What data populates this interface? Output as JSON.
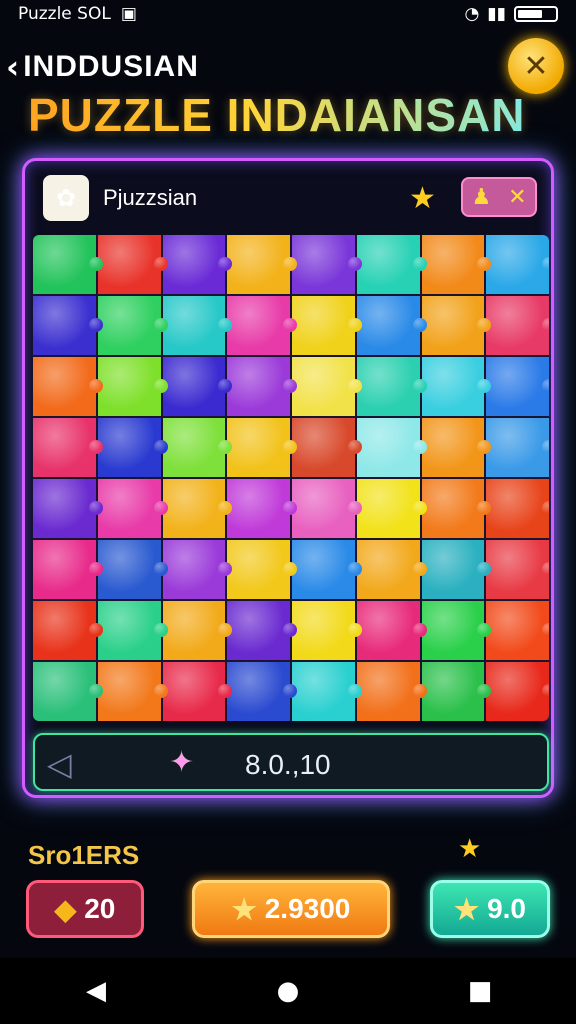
{
  "statusbar": {
    "app_label": "Puzzle SOL",
    "app_icon": "image-icon",
    "icons": [
      "wifi-icon",
      "signal-icon",
      "battery-icon"
    ]
  },
  "header": {
    "back_label": "INDDUSIAN",
    "title": "PUZZLE INDAIANSAN"
  },
  "panel": {
    "title": "Pjuzzsian",
    "app_icon": "flower-icon",
    "star": "★",
    "tool_glyphs": [
      "♟",
      "✕"
    ]
  },
  "puzzle": {
    "rows": 8,
    "cols": 8,
    "colors": [
      "#22c35a",
      "#e8332a",
      "#6a2bd6",
      "#f3b21a",
      "#7a36d9",
      "#26d1b4",
      "#f28a1a",
      "#2aa8e8",
      "#3b2fd0",
      "#2fd060",
      "#27c8c8",
      "#e83aa8",
      "#f0d21a",
      "#2a8ae8",
      "#f2a21a",
      "#e83a66",
      "#f26a1a",
      "#7ee02a",
      "#3a2ad0",
      "#9b3ad9",
      "#f2e24a",
      "#2ad0b0",
      "#3acfe0",
      "#2a7ae8",
      "#e8336a",
      "#2a3ad0",
      "#7ee03a",
      "#f2c21a",
      "#d8482a",
      "#8fe8e8",
      "#f2961a",
      "#3a9ae8",
      "#6a2ad0",
      "#e83aa8",
      "#f2b21a",
      "#c03ad9",
      "#e860c0",
      "#f2e21a",
      "#f27a1a",
      "#e8441a",
      "#e82a8a",
      "#2a5ad0",
      "#9a3ad9",
      "#f2c81a",
      "#2a8ae8",
      "#f2a81a",
      "#2ab0c0",
      "#e83a44",
      "#e8321a",
      "#2ad08a",
      "#f2aa1a",
      "#6a2ad0",
      "#f2da1a",
      "#e82a7a",
      "#2ad04a",
      "#f24a1a",
      "#2ac07a",
      "#f2781a",
      "#e82a4a",
      "#2a4ad0",
      "#2ad0d0",
      "#f2701a",
      "#2ac04a",
      "#e8281a"
    ]
  },
  "controls": {
    "prev_icon": "triangle-left-icon",
    "spark_icon": "sparkle-icon",
    "value": "8.0.,10"
  },
  "scores": {
    "label": "Sro1ERS",
    "star": "★",
    "items": [
      {
        "icon": "gem-icon",
        "glyph": "◆",
        "value": "20"
      },
      {
        "icon": "star-icon",
        "glyph": "★",
        "value": "2.9300"
      },
      {
        "icon": "star-icon",
        "glyph": "★",
        "value": "9.0"
      }
    ]
  },
  "navbar": {
    "back": "◀",
    "home": "●",
    "recents": "■"
  }
}
